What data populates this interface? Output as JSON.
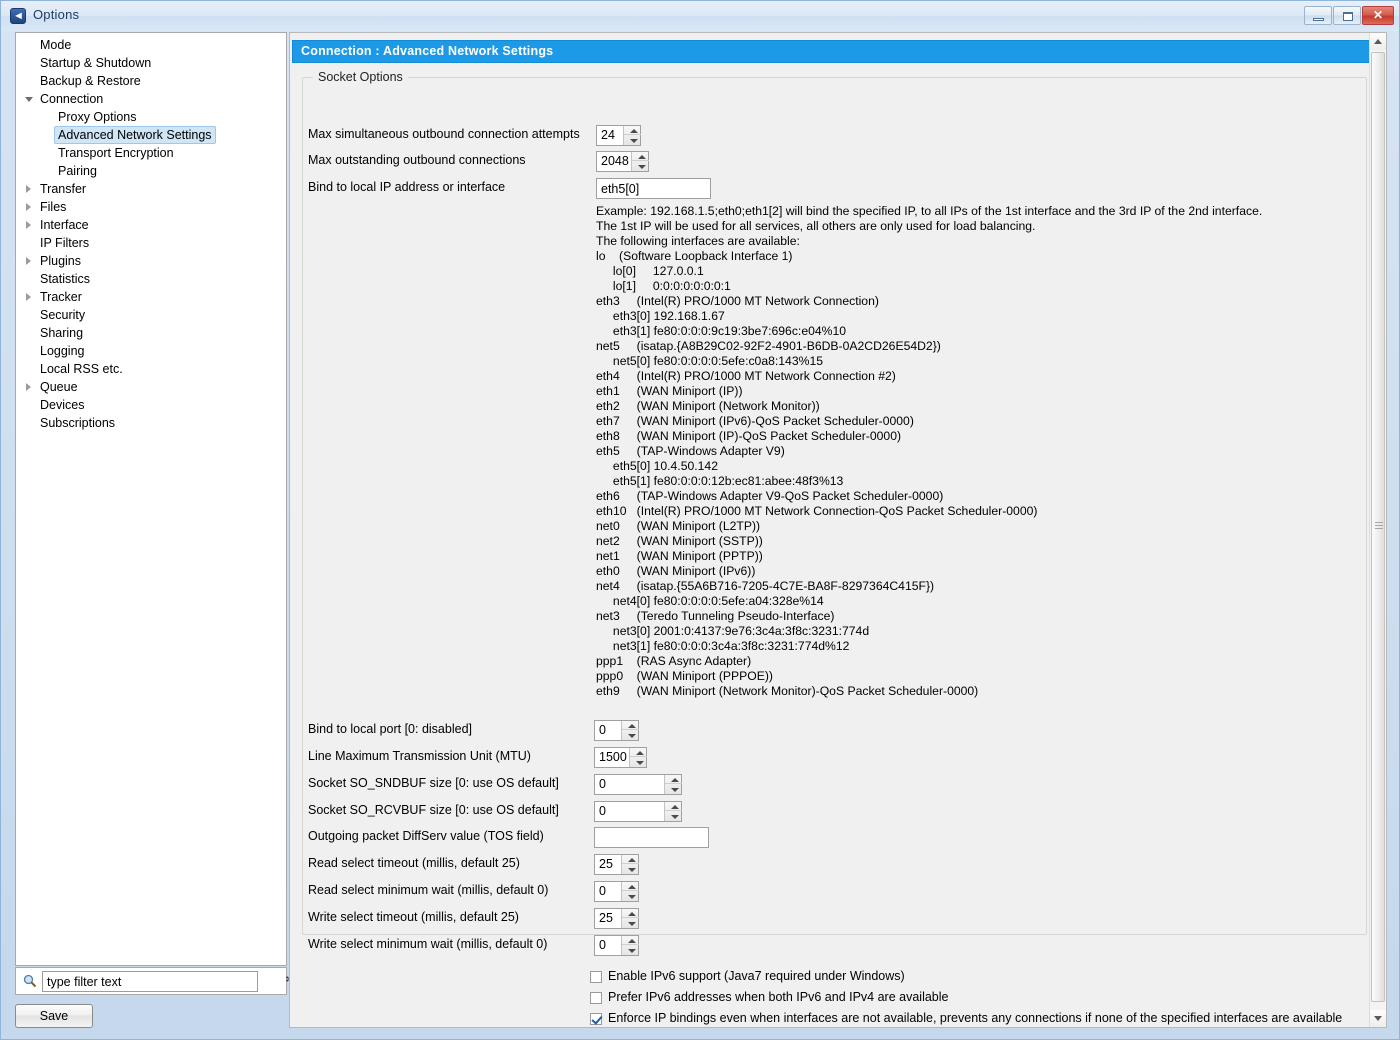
{
  "window": {
    "title": "Options",
    "icon": "vuze-app-icon",
    "minimize_label": "",
    "maximize_label": "",
    "close_label": "✕"
  },
  "sidebar": {
    "items": [
      {
        "label": "Mode",
        "level": 0,
        "twisty": "none",
        "selected": false
      },
      {
        "label": "Startup & Shutdown",
        "level": 0,
        "twisty": "none",
        "selected": false
      },
      {
        "label": "Backup & Restore",
        "level": 0,
        "twisty": "none",
        "selected": false
      },
      {
        "label": "Connection",
        "level": 0,
        "twisty": "expanded",
        "selected": false
      },
      {
        "label": "Proxy Options",
        "level": 1,
        "twisty": "none",
        "selected": false
      },
      {
        "label": "Advanced Network Settings",
        "level": 1,
        "twisty": "none",
        "selected": true
      },
      {
        "label": "Transport Encryption",
        "level": 1,
        "twisty": "none",
        "selected": false
      },
      {
        "label": "Pairing",
        "level": 1,
        "twisty": "none",
        "selected": false
      },
      {
        "label": "Transfer",
        "level": 0,
        "twisty": "collapsed",
        "selected": false
      },
      {
        "label": "Files",
        "level": 0,
        "twisty": "collapsed",
        "selected": false
      },
      {
        "label": "Interface",
        "level": 0,
        "twisty": "collapsed",
        "selected": false
      },
      {
        "label": "IP Filters",
        "level": 0,
        "twisty": "none",
        "selected": false
      },
      {
        "label": "Plugins",
        "level": 0,
        "twisty": "collapsed",
        "selected": false
      },
      {
        "label": "Statistics",
        "level": 0,
        "twisty": "none",
        "selected": false
      },
      {
        "label": "Tracker",
        "level": 0,
        "twisty": "collapsed",
        "selected": false
      },
      {
        "label": "Security",
        "level": 0,
        "twisty": "none",
        "selected": false
      },
      {
        "label": "Sharing",
        "level": 0,
        "twisty": "none",
        "selected": false
      },
      {
        "label": "Logging",
        "level": 0,
        "twisty": "none",
        "selected": false
      },
      {
        "label": "Local RSS etc.",
        "level": 0,
        "twisty": "none",
        "selected": false
      },
      {
        "label": "Queue",
        "level": 0,
        "twisty": "collapsed",
        "selected": false
      },
      {
        "label": "Devices",
        "level": 0,
        "twisty": "none",
        "selected": false
      },
      {
        "label": "Subscriptions",
        "level": 0,
        "twisty": "none",
        "selected": false
      }
    ]
  },
  "filter": {
    "value": "type filter text",
    "placeholder": "type filter text",
    "icon": "search-icon",
    "clear_icon": "✻"
  },
  "save": {
    "label": "Save"
  },
  "page": {
    "header": "Connection : Advanced Network Settings",
    "group_label": "Socket Options",
    "accent_color": "#1c9ae8"
  },
  "fields": {
    "max_attempts": {
      "label": "Max simultaneous outbound connection attempts",
      "value": "24"
    },
    "max_outstanding": {
      "label": "Max outstanding outbound connections",
      "value": "2048"
    },
    "bind_ip": {
      "label": "Bind to local IP address or interface",
      "value": "eth5[0]"
    },
    "bind_port": {
      "label": "Bind to local port [0: disabled]",
      "value": "0"
    },
    "mtu": {
      "label": "Line Maximum Transmission Unit (MTU)",
      "value": "1500"
    },
    "sndbuf": {
      "label": "Socket SO_SNDBUF size [0: use OS default]",
      "value": "0"
    },
    "rcvbuf": {
      "label": "Socket SO_RCVBUF size [0: use OS default]",
      "value": "0"
    },
    "diffserv": {
      "label": "Outgoing packet DiffServ value (TOS field)",
      "value": ""
    },
    "read_timeout": {
      "label": "Read select timeout (millis, default 25)",
      "value": "25"
    },
    "read_min_wait": {
      "label": "Read select minimum wait (millis, default 0)",
      "value": "0"
    },
    "write_timeout": {
      "label": "Write select timeout (millis, default 25)",
      "value": "25"
    },
    "write_min_wait": {
      "label": "Write select minimum wait (millis, default 0)",
      "value": "0"
    }
  },
  "interfaces_text": [
    "Example: 192.168.1.5;eth0;eth1[2] will bind the specified IP, to all IPs of the 1st interface and the 3rd IP of the 2nd interface.",
    "The 1st IP will be used for all services, all others are only used for load balancing.",
    "The following interfaces are available:",
    "lo    (Software Loopback Interface 1)",
    "     lo[0]     127.0.0.1",
    "     lo[1]     0:0:0:0:0:0:0:1",
    "eth3     (Intel(R) PRO/1000 MT Network Connection)",
    "     eth3[0] 192.168.1.67",
    "     eth3[1] fe80:0:0:0:9c19:3be7:696c:e04%10",
    "net5     (isatap.{A8B29C02-92F2-4901-B6DB-0A2CD26E54D2})",
    "     net5[0] fe80:0:0:0:0:5efe:c0a8:143%15",
    "eth4     (Intel(R) PRO/1000 MT Network Connection #2)",
    "eth1     (WAN Miniport (IP))",
    "eth2     (WAN Miniport (Network Monitor))",
    "eth7     (WAN Miniport (IPv6)-QoS Packet Scheduler-0000)",
    "eth8     (WAN Miniport (IP)-QoS Packet Scheduler-0000)",
    "eth5     (TAP-Windows Adapter V9)",
    "     eth5[0] 10.4.50.142",
    "     eth5[1] fe80:0:0:0:12b:ec81:abee:48f3%13",
    "eth6     (TAP-Windows Adapter V9-QoS Packet Scheduler-0000)",
    "eth10   (Intel(R) PRO/1000 MT Network Connection-QoS Packet Scheduler-0000)",
    "net0     (WAN Miniport (L2TP))",
    "net2     (WAN Miniport (SSTP))",
    "net1     (WAN Miniport (PPTP))",
    "eth0     (WAN Miniport (IPv6))",
    "net4     (isatap.{55A6B716-7205-4C7E-BA8F-8297364C415F})",
    "     net4[0] fe80:0:0:0:0:5efe:a04:328e%14",
    "net3     (Teredo Tunneling Pseudo-Interface)",
    "     net3[0] 2001:0:4137:9e76:3c4a:3f8c:3231:774d",
    "     net3[1] fe80:0:0:0:3c4a:3f8c:3231:774d%12",
    "ppp1    (RAS Async Adapter)",
    "ppp0    (WAN Miniport (PPPOE))",
    "eth9     (WAN Miniport (Network Monitor)-QoS Packet Scheduler-0000)"
  ],
  "checkboxes": [
    {
      "label": "Enable IPv6 support (Java7 required under Windows)",
      "checked": false
    },
    {
      "label": "Prefer IPv6 addresses when both IPv6 and IPv4 are available",
      "checked": false
    },
    {
      "label": "Enforce IP bindings even when interfaces are not available, prevents any connections if none of the specified interfaces are available",
      "checked": true
    }
  ]
}
